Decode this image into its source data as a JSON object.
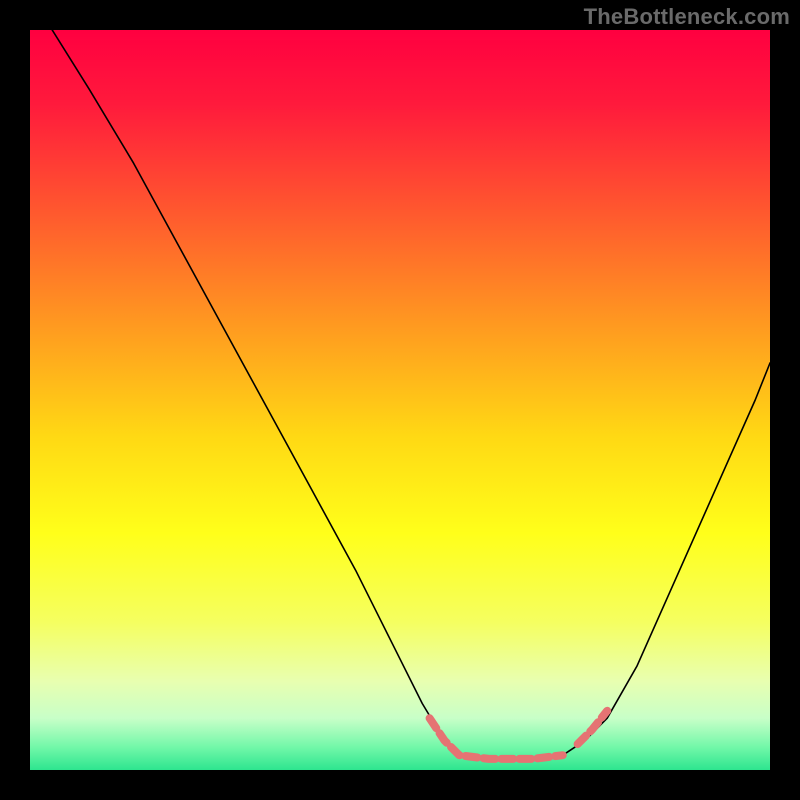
{
  "watermark": {
    "text": "TheBottleneck.com"
  },
  "chart_data": {
    "type": "line",
    "title": "",
    "xlabel": "",
    "ylabel": "",
    "xlim": [
      0,
      100
    ],
    "ylim": [
      0,
      100
    ],
    "grid": false,
    "legend": false,
    "background": {
      "gradient_stops": [
        {
          "offset": 0.0,
          "color": "#ff0040"
        },
        {
          "offset": 0.1,
          "color": "#ff1a3c"
        },
        {
          "offset": 0.25,
          "color": "#ff5a2e"
        },
        {
          "offset": 0.4,
          "color": "#ff9a20"
        },
        {
          "offset": 0.55,
          "color": "#ffd914"
        },
        {
          "offset": 0.68,
          "color": "#ffff1a"
        },
        {
          "offset": 0.8,
          "color": "#f5ff60"
        },
        {
          "offset": 0.88,
          "color": "#e8ffb0"
        },
        {
          "offset": 0.93,
          "color": "#c8ffc8"
        },
        {
          "offset": 0.97,
          "color": "#70f7a8"
        },
        {
          "offset": 1.0,
          "color": "#2de58f"
        }
      ]
    },
    "series": [
      {
        "name": "bottleneck-curve",
        "color": "#000000",
        "width": 1.6,
        "points": [
          {
            "x": 3,
            "y": 100
          },
          {
            "x": 8,
            "y": 92
          },
          {
            "x": 14,
            "y": 82
          },
          {
            "x": 20,
            "y": 71
          },
          {
            "x": 26,
            "y": 60
          },
          {
            "x": 32,
            "y": 49
          },
          {
            "x": 38,
            "y": 38
          },
          {
            "x": 44,
            "y": 27
          },
          {
            "x": 49,
            "y": 17
          },
          {
            "x": 53,
            "y": 9
          },
          {
            "x": 56,
            "y": 4
          },
          {
            "x": 58,
            "y": 2
          },
          {
            "x": 62,
            "y": 1.5
          },
          {
            "x": 68,
            "y": 1.5
          },
          {
            "x": 72,
            "y": 2
          },
          {
            "x": 75,
            "y": 4
          },
          {
            "x": 78,
            "y": 7
          },
          {
            "x": 82,
            "y": 14
          },
          {
            "x": 86,
            "y": 23
          },
          {
            "x": 90,
            "y": 32
          },
          {
            "x": 94,
            "y": 41
          },
          {
            "x": 98,
            "y": 50
          },
          {
            "x": 100,
            "y": 55
          }
        ]
      },
      {
        "name": "highlight-left",
        "color": "#e57373",
        "width": 8,
        "dash": [
          12,
          6
        ],
        "points": [
          {
            "x": 54,
            "y": 7
          },
          {
            "x": 56,
            "y": 4
          },
          {
            "x": 58,
            "y": 2
          },
          {
            "x": 62,
            "y": 1.5
          },
          {
            "x": 68,
            "y": 1.5
          },
          {
            "x": 72,
            "y": 2
          }
        ]
      },
      {
        "name": "highlight-right",
        "color": "#e57373",
        "width": 8,
        "dash": [
          12,
          6
        ],
        "points": [
          {
            "x": 74,
            "y": 3.5
          },
          {
            "x": 76,
            "y": 5.5
          },
          {
            "x": 78,
            "y": 8
          }
        ]
      }
    ]
  }
}
